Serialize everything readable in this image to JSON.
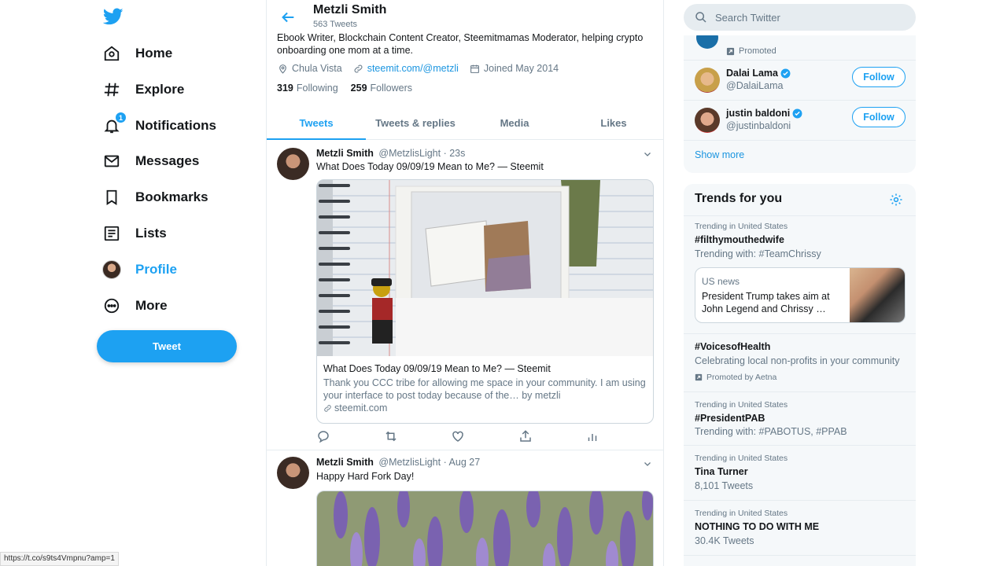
{
  "nav": {
    "items": [
      {
        "label": "Home",
        "icon": "home-icon"
      },
      {
        "label": "Explore",
        "icon": "hashtag-icon"
      },
      {
        "label": "Notifications",
        "icon": "bell-icon",
        "badge": "1"
      },
      {
        "label": "Messages",
        "icon": "envelope-icon"
      },
      {
        "label": "Bookmarks",
        "icon": "bookmark-icon"
      },
      {
        "label": "Lists",
        "icon": "list-icon"
      },
      {
        "label": "Profile",
        "icon": "avatar",
        "active": true
      },
      {
        "label": "More",
        "icon": "more-dots-icon"
      }
    ],
    "tweet_button": "Tweet",
    "status_url": "https://t.co/s9ts4Vmpnu?amp=1",
    "accent_color": "#1da1f2"
  },
  "profile": {
    "name": "Metzli Smith",
    "tweet_count": "563 Tweets",
    "bio_line1": "Ebook Writer, Blockchain Content Creator, Steemitmamas Moderator, helping crypto",
    "bio_line2": "onboarding one mom at a time.",
    "location": "Chula Vista",
    "website": "steemit.com/@metzli",
    "joined": "Joined May 2014",
    "following_count": "319",
    "following_label": "Following",
    "followers_count": "259",
    "followers_label": "Followers"
  },
  "tabs": [
    "Tweets",
    "Tweets & replies",
    "Media",
    "Likes"
  ],
  "tweets": [
    {
      "name": "Metzli Smith",
      "handle": "@MetzlisLight",
      "time": "· 23s",
      "text": "What Does Today 09/09/19 Mean to Me? — Steemit",
      "card_title": "What Does Today 09/09/19 Mean to Me? — Steemit",
      "card_desc": "Thank you CCC tribe for allowing me space in your community. I am using your interface to post today because of the… by metzli",
      "card_link": "steemit.com"
    },
    {
      "name": "Metzli Smith",
      "handle": "@MetzlisLight",
      "time": "· Aug 27",
      "text": "Happy Hard Fork Day!"
    }
  ],
  "search": {
    "placeholder": "Search Twitter"
  },
  "who_to_follow": {
    "promoted_label": "Promoted",
    "accounts": [
      {
        "name": "Dalai Lama",
        "handle": "@DalaiLama",
        "button": "Follow"
      },
      {
        "name": "justin baldoni",
        "handle": "@justinbaldoni",
        "button": "Follow"
      }
    ],
    "show_more": "Show more"
  },
  "trends": {
    "title": "Trends for you",
    "items": [
      {
        "context": "Trending in United States",
        "name": "#filthymouthedwife",
        "sub": "Trending with: #TeamChrissy"
      },
      {
        "context": "",
        "name": "#VoicesofHealth",
        "sub": "Celebrating local non-profits in your community",
        "promoted": "Promoted by Aetna"
      },
      {
        "context": "Trending in United States",
        "name": "#PresidentPAB",
        "sub": "Trending with: #PABOTUS, #PPAB"
      },
      {
        "context": "Trending in United States",
        "name": "Tina Turner",
        "sub": "8,101 Tweets"
      },
      {
        "context": "Trending in United States",
        "name": "NOTHING TO DO WITH ME",
        "sub": "30.4K Tweets"
      }
    ],
    "news": {
      "category": "US news",
      "title": "President Trump takes aim at John Legend and Chrissy …"
    }
  }
}
